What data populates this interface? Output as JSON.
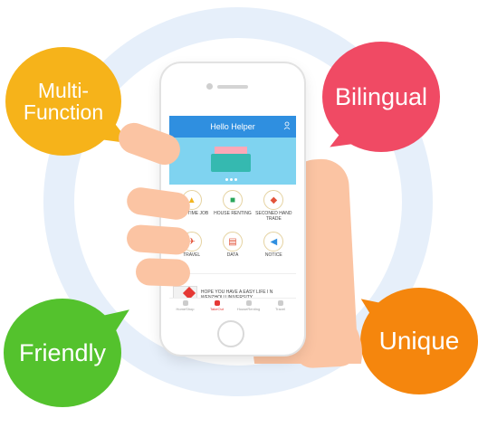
{
  "bubbles": {
    "multi_function": {
      "line1": "Multi-",
      "line2": "Function",
      "color": "#f6b31a"
    },
    "bilingual": {
      "label": "Bilingual",
      "color": "#f04a64"
    },
    "friendly": {
      "label": "Friendly",
      "color": "#54c22d"
    },
    "unique": {
      "label": "Unique",
      "color": "#f5860d"
    }
  },
  "app": {
    "title": "Hello Helper",
    "grid": [
      {
        "label": "PART TIME JOB",
        "icon": "briefcase-icon",
        "glyph": "▲",
        "color": "#f2b520"
      },
      {
        "label": "HOUSE RENTING",
        "icon": "house-icon",
        "glyph": "■",
        "color": "#2aa65c"
      },
      {
        "label": "SECONED HAND TRADE",
        "icon": "trade-icon",
        "glyph": "◆",
        "color": "#e2533a"
      },
      {
        "label": "TRAVEL",
        "icon": "travel-icon",
        "glyph": "✈",
        "color": "#e2533a"
      },
      {
        "label": "DATA",
        "icon": "data-icon",
        "glyph": "▤",
        "color": "#e2533a"
      },
      {
        "label": "NOTICE",
        "icon": "megaphone-icon",
        "glyph": "◀",
        "color": "#2f8fe0"
      }
    ],
    "news": {
      "heading": "Hello",
      "text": "HOPE YOU HAVE A EASY LIFE I N WENZHOU UNIVERSITY"
    },
    "tabs": [
      "HomeShop",
      "TakeOut",
      "HouseRenting",
      "Travel"
    ],
    "active_tab": "TakeOut"
  },
  "colors": {
    "ring": "#e6effa",
    "app_bar": "#2f8fe0",
    "skin": "#fbc4a3"
  }
}
